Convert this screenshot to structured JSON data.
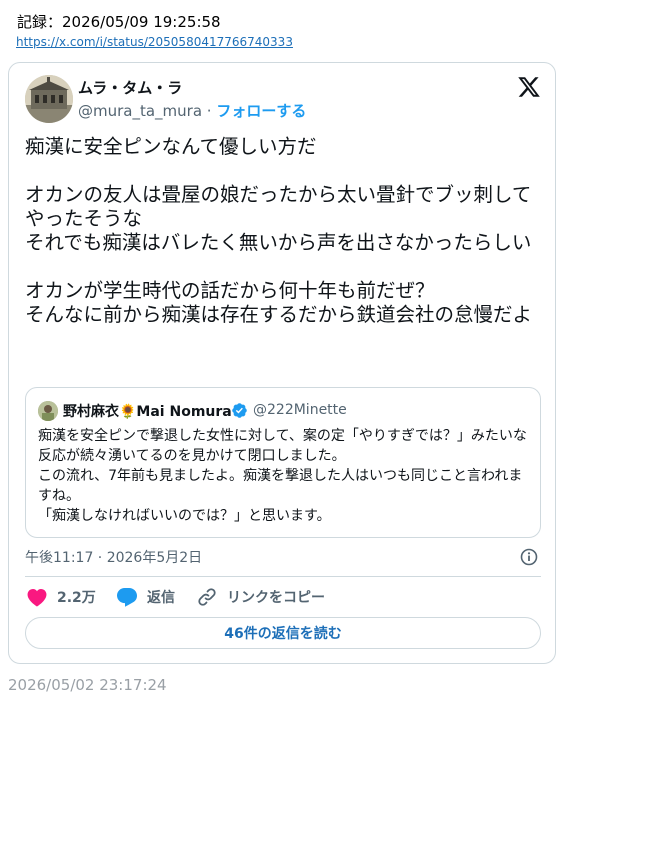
{
  "record": {
    "label": "記録：2026/05/09 19:25:58",
    "url": "https://x.com/i/status/2050580417766740333"
  },
  "tweet": {
    "author_name": "ムラ・タム・ラ",
    "author_handle": "@mura_ta_mura",
    "separator": " · ",
    "follow_label": "フォローする",
    "text": "痴漢に安全ピンなんて優しい方だ\n\nオカンの友人は畳屋の娘だったから太い畳針でブッ刺してやったそうな\nそれでも痴漢はバレたく無いから声を出さなかったらしい\n\nオカンが学生時代の話だから何十年も前だぜ？\nそんなに前から痴漢は存在するだから鉄道会社の怠慢だよ",
    "timestamp": "午後11:17 · 2026年5月2日"
  },
  "quote": {
    "author_name": "野村麻衣🌻Mai Nomura",
    "author_handle": "@222Minette",
    "text": "痴漢を安全ピンで撃退した女性に対して、案の定「やりすぎでは？」みたいな反応が続々湧いてるのを見かけて閉口しました。\nこの流れ、7年前も見ましたよ。痴漢を撃退した人はいつも同じこと言われますね。\n「痴漢しなければいいのでは？」と思います。"
  },
  "actions": {
    "likes": "2.2万",
    "reply": "返信",
    "copy_link": "リンクをコピー",
    "read_replies": "46件の返信を読む"
  },
  "footer": {
    "date": "2026/05/02 23:17:24"
  },
  "colors": {
    "like": "#f91880",
    "reply": "#1d9bf0",
    "link": "#1d9bf0",
    "border": "#cfd9de",
    "muted": "#536471"
  },
  "icons": [
    "x-logo-icon",
    "verified-badge-icon",
    "info-icon",
    "heart-icon",
    "reply-bubble-icon",
    "link-icon"
  ]
}
